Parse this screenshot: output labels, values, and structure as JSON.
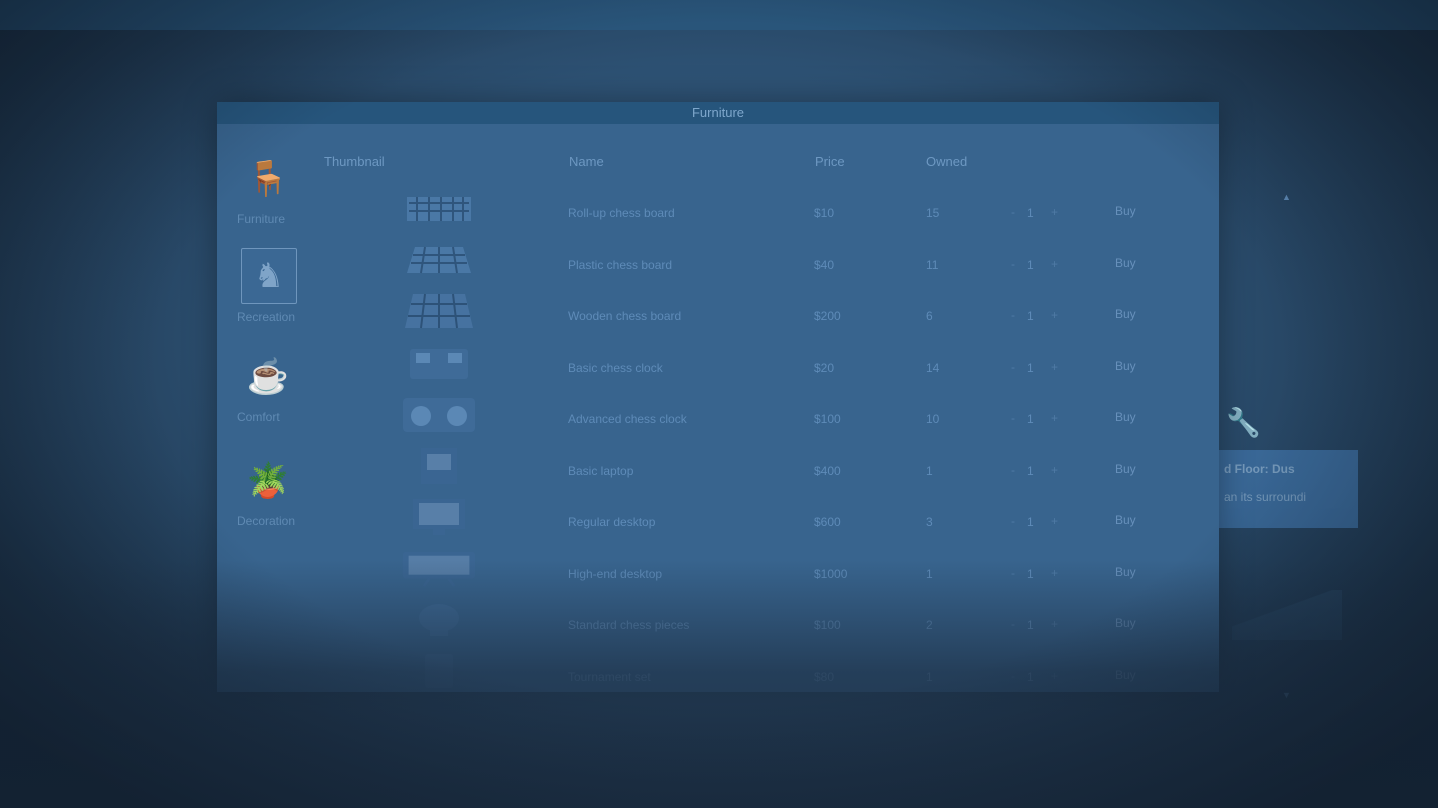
{
  "window": {
    "title": "Furniture"
  },
  "background_card": {
    "line1": "d Floor: Dus",
    "line2": "an its surroundi"
  },
  "categories": [
    {
      "label": "Furniture",
      "icon": "chair-icon",
      "glyph": "🪑",
      "selected": false
    },
    {
      "label": "Recreation",
      "icon": "chess-piece-icon",
      "glyph": "♞",
      "selected": true
    },
    {
      "label": "Comfort",
      "icon": "mug-icon",
      "glyph": "☕",
      "selected": false
    },
    {
      "label": "Decoration",
      "icon": "plant-icon",
      "glyph": "🪴",
      "selected": false
    }
  ],
  "columns": {
    "thumbnail": "Thumbnail",
    "name": "Name",
    "price": "Price",
    "owned": "Owned"
  },
  "items": [
    {
      "name": "Roll-up chess board",
      "price": "$10",
      "owned": "15",
      "qty": "1",
      "buy": "Buy",
      "icon": "rollup-chessboard-icon"
    },
    {
      "name": "Plastic chess board",
      "price": "$40",
      "owned": "11",
      "qty": "1",
      "buy": "Buy",
      "icon": "plastic-chessboard-icon"
    },
    {
      "name": "Wooden chess board",
      "price": "$200",
      "owned": "6",
      "qty": "1",
      "buy": "Buy",
      "icon": "wooden-chessboard-icon"
    },
    {
      "name": "Basic chess clock",
      "price": "$20",
      "owned": "14",
      "qty": "1",
      "buy": "Buy",
      "icon": "basic-chess-clock-icon"
    },
    {
      "name": "Advanced chess clock",
      "price": "$100",
      "owned": "10",
      "qty": "1",
      "buy": "Buy",
      "icon": "advanced-chess-clock-icon"
    },
    {
      "name": "Basic laptop",
      "price": "$400",
      "owned": "1",
      "qty": "1",
      "buy": "Buy",
      "icon": "basic-laptop-icon"
    },
    {
      "name": "Regular desktop",
      "price": "$600",
      "owned": "3",
      "qty": "1",
      "buy": "Buy",
      "icon": "regular-desktop-icon"
    },
    {
      "name": "High-end desktop",
      "price": "$1000",
      "owned": "1",
      "qty": "1",
      "buy": "Buy",
      "icon": "highend-desktop-icon"
    },
    {
      "name": "Standard chess pieces",
      "price": "$100",
      "owned": "2",
      "qty": "1",
      "buy": "Buy",
      "icon": "chess-pieces-icon"
    },
    {
      "name": "Tournament set",
      "price": "$80",
      "owned": "1",
      "qty": "1",
      "buy": "Buy",
      "icon": "tournament-set-icon"
    }
  ],
  "controls": {
    "decrement": "-",
    "increment": "+"
  },
  "scroll": {
    "up": "▲",
    "down": "▼"
  }
}
